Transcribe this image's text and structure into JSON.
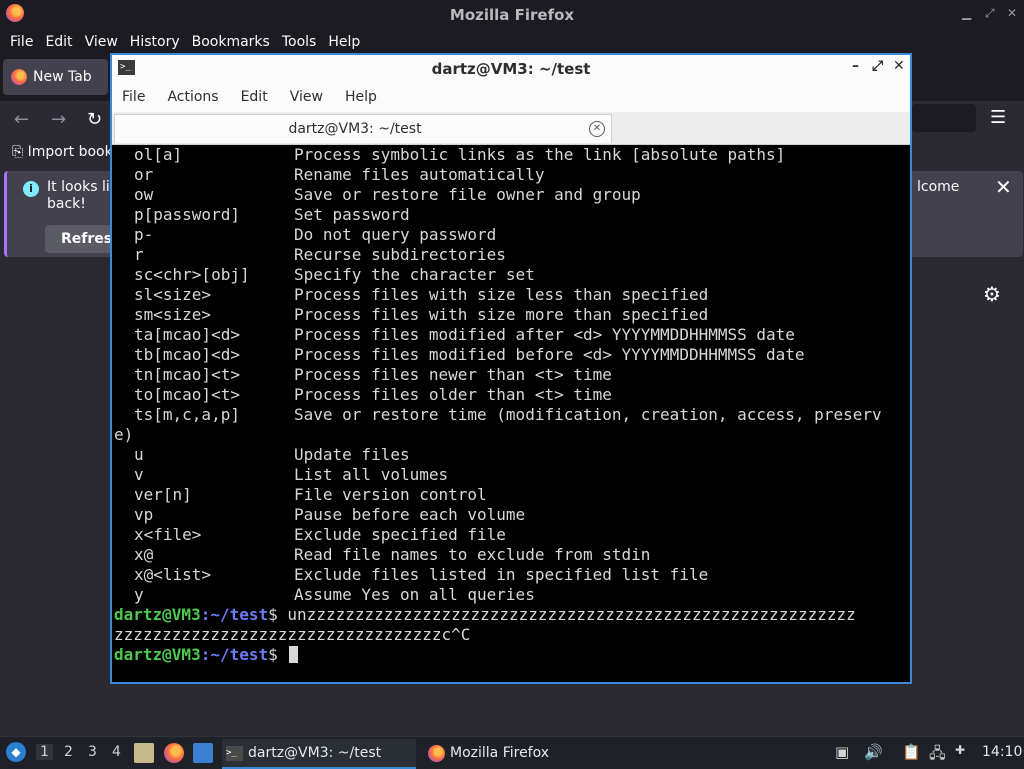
{
  "firefox": {
    "window_title": "Mozilla Firefox",
    "menu": [
      "File",
      "Edit",
      "View",
      "History",
      "Bookmarks",
      "Tools",
      "Help"
    ],
    "tab_label": "New Tab",
    "import_bookmarks": "Import book",
    "notice_line1": "It looks lik",
    "notice_line2": "back!",
    "notice_right": "lcome",
    "refresh_label": "Refresh"
  },
  "terminal": {
    "window_title": "dartz@VM3: ~/test",
    "menu": [
      "File",
      "Actions",
      "Edit",
      "View",
      "Help"
    ],
    "tab_title": "dartz@VM3: ~/test",
    "options": [
      {
        "opt": "ol[a]",
        "desc": "Process symbolic links as the link [absolute paths]"
      },
      {
        "opt": "or",
        "desc": "Rename files automatically"
      },
      {
        "opt": "ow",
        "desc": "Save or restore file owner and group"
      },
      {
        "opt": "p[password]",
        "desc": "Set password"
      },
      {
        "opt": "p-",
        "desc": "Do not query password"
      },
      {
        "opt": "r",
        "desc": "Recurse subdirectories"
      },
      {
        "opt": "sc<chr>[obj]",
        "desc": "Specify the character set"
      },
      {
        "opt": "sl<size>",
        "desc": "Process files with size less than specified"
      },
      {
        "opt": "sm<size>",
        "desc": "Process files with size more than specified"
      },
      {
        "opt": "ta[mcao]<d>",
        "desc": "Process files modified after <d> YYYYMMDDHHMMSS date"
      },
      {
        "opt": "tb[mcao]<d>",
        "desc": "Process files modified before <d> YYYYMMDDHHMMSS date"
      },
      {
        "opt": "tn[mcao]<t>",
        "desc": "Process files newer than <t> time"
      },
      {
        "opt": "to[mcao]<t>",
        "desc": "Process files older than <t> time"
      },
      {
        "opt": "ts[m,c,a,p]",
        "desc": "Save or restore time (modification, creation, access, preserv"
      }
    ],
    "wrap_line": "e)",
    "options2": [
      {
        "opt": "u",
        "desc": "Update files"
      },
      {
        "opt": "v",
        "desc": "List all volumes"
      },
      {
        "opt": "ver[n]",
        "desc": "File version control"
      },
      {
        "opt": "vp",
        "desc": "Pause before each volume"
      },
      {
        "opt": "x<file>",
        "desc": "Exclude specified file"
      },
      {
        "opt": "x@",
        "desc": "Read file names to exclude from stdin"
      },
      {
        "opt": "x@<list>",
        "desc": "Exclude files listed in specified list file"
      },
      {
        "opt": "y",
        "desc": "Assume Yes on all queries"
      }
    ],
    "prompt_user": "dartz@VM3",
    "prompt_path": ":~/test",
    "prompt_symbol": "$",
    "command_line1": " unzzzzzzzzzzzzzzzzzzzzzzzzzzzzzzzzzzzzzzzzzzzzzzzzzzzzzzzzz",
    "command_line2": "zzzzzzzzzzzzzzzzzzzzzzzzzzzzzzzzzzc^C"
  },
  "taskbar": {
    "workspaces": [
      "1",
      "2",
      "3",
      "4"
    ],
    "active_workspace": "1",
    "task_terminal": "dartz@VM3: ~/test",
    "task_firefox": "Mozilla Firefox",
    "clock": "14:10"
  }
}
